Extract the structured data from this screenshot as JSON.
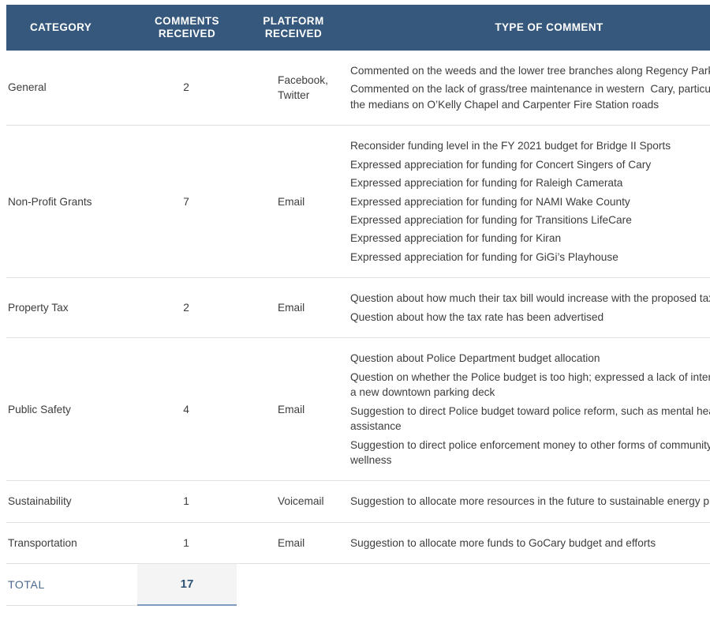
{
  "table": {
    "columns": [
      {
        "key": "category",
        "label": "CATEGORY"
      },
      {
        "key": "count",
        "label": "COMMENTS RECEIVED",
        "line1": "COMMENTS",
        "line2": "RECEIVED"
      },
      {
        "key": "platform",
        "label": "PLATFORM RECEIVED",
        "line1": "PLATFORM",
        "line2": "RECEIVED"
      },
      {
        "key": "type",
        "label": "TYPE OF COMMENT"
      }
    ],
    "header_background": "#36587c",
    "header_text_color": "#ffffff",
    "divider_color": "#e2e2e2",
    "total_accent_color": "#7e9cbd",
    "total_value_background": "#f4f4f4",
    "total_text_color": "#4b6a8c",
    "rows": [
      {
        "category": "General",
        "count": "2",
        "platform": "Facebook, Twitter",
        "comments": [
          "Commented on the weeds and the lower tree branches along Regency Parkway",
          "Commented on the lack of grass/tree maintenance in western  Cary, particularly the medians on O’Kelly Chapel and Carpenter Fire Station roads"
        ]
      },
      {
        "category": "Non-Profit Grants",
        "count": "7",
        "platform": "Email",
        "comments": [
          "Reconsider funding level in the FY 2021 budget for Bridge II Sports",
          "Expressed appreciation for funding for Concert Singers of Cary",
          "Expressed appreciation for funding for Raleigh Camerata",
          "Expressed appreciation for funding for NAMI Wake County",
          "Expressed appreciation for funding for Transitions LifeCare",
          "Expressed appreciation for funding for Kiran",
          "Expressed appreciation for funding for GiGi’s Playhouse"
        ]
      },
      {
        "category": "Property Tax",
        "count": "2",
        "platform": "Email",
        "comments": [
          "Question about how much their tax bill would increase with the proposed tax rate",
          "Question about how the tax rate has been advertised"
        ]
      },
      {
        "category": "Public Safety",
        "count": "4",
        "platform": "Email",
        "comments": [
          "Question about Police Department budget allocation",
          "Question on whether the Police budget is too high; expressed a lack of interest in a new downtown parking deck",
          "Suggestion to direct Police budget toward police reform, such as mental health assistance",
          "Suggestion to direct police enforcement money to other forms of community wellness"
        ]
      },
      {
        "category": "Sustainability",
        "count": "1",
        "platform": "Voicemail",
        "comments": [
          "Suggestion to allocate more resources in the future to sustainable energy projects"
        ]
      },
      {
        "category": "Transportation",
        "count": "1",
        "platform": "Email",
        "comments": [
          "Suggestion to allocate more funds to GoCary budget and efforts"
        ]
      }
    ],
    "total": {
      "label": "TOTAL",
      "value": "17"
    }
  }
}
